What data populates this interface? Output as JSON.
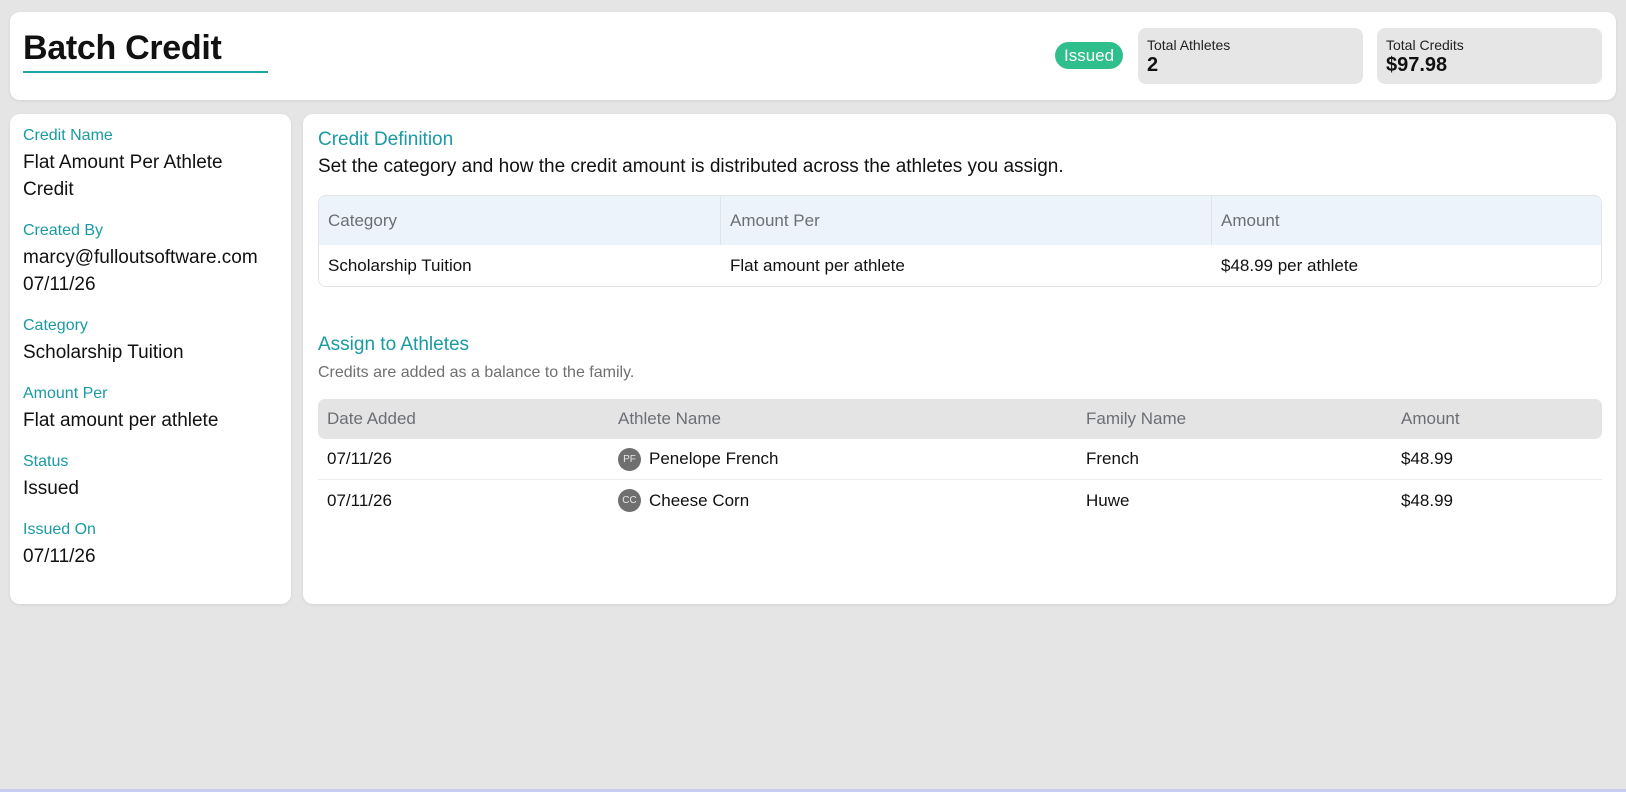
{
  "header": {
    "title": "Batch Credit",
    "status": "Issued",
    "stats": [
      {
        "label": "Total Athletes",
        "value": "2"
      },
      {
        "label": "Total Credits",
        "value": "$97.98"
      }
    ]
  },
  "sidebar": {
    "fields": [
      {
        "label": "Credit Name",
        "value": "Flat Amount Per Athlete Credit"
      },
      {
        "label": "Created By",
        "value": "marcy@fulloutsoftware.com",
        "value2": "07/11/26"
      },
      {
        "label": "Category",
        "value": "Scholarship Tuition"
      },
      {
        "label": "Amount Per",
        "value": "Flat amount per athlete"
      },
      {
        "label": "Status",
        "value": "Issued"
      },
      {
        "label": "Issued On",
        "value": "07/11/26"
      }
    ]
  },
  "definition": {
    "title": "Credit Definition",
    "description": "Set the category and how the credit amount is distributed across the athletes you assign.",
    "columns": [
      "Category",
      "Amount Per",
      "Amount"
    ],
    "row": [
      "Scholarship Tuition",
      "Flat amount per athlete",
      "$48.99 per athlete"
    ]
  },
  "assign": {
    "title": "Assign to Athletes",
    "description": "Credits are added as a balance to the family.",
    "columns": [
      "Date Added",
      "Athlete Name",
      "Family Name",
      "Amount"
    ],
    "rows": [
      {
        "date": "07/11/26",
        "initials": "PF",
        "athlete": "Penelope French",
        "family": "French",
        "amount": "$48.99"
      },
      {
        "date": "07/11/26",
        "initials": "CC",
        "athlete": "Cheese Corn",
        "family": "Huwe",
        "amount": "$48.99"
      }
    ]
  },
  "colors": {
    "accent": "#1a9aa3",
    "status_green": "#2fbf8c"
  }
}
